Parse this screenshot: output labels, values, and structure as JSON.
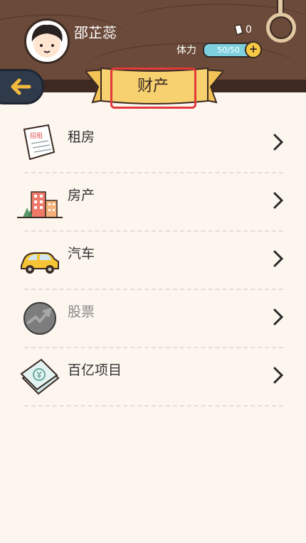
{
  "header": {
    "username": "邵芷蕊",
    "gem_count": "0",
    "stamina_label": "体力",
    "stamina_value": "50/50",
    "plus_label": "+"
  },
  "page": {
    "title": "财产"
  },
  "menu": {
    "items": [
      {
        "label": "租房",
        "icon": "rent-sign-icon",
        "enabled": true
      },
      {
        "label": "房产",
        "icon": "buildings-icon",
        "enabled": true
      },
      {
        "label": "汽车",
        "icon": "car-icon",
        "enabled": true
      },
      {
        "label": "股票",
        "icon": "stock-icon",
        "enabled": false
      },
      {
        "label": "百亿项目",
        "icon": "money-stack-icon",
        "enabled": true
      }
    ],
    "rent_sign_text": "招租"
  }
}
